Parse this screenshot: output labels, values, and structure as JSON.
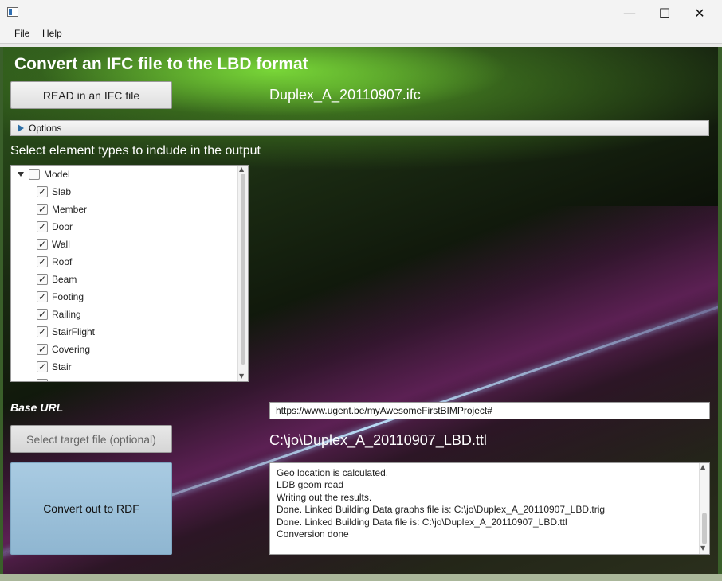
{
  "window": {
    "minimize_glyph": "—",
    "maximize_glyph": "☐",
    "close_glyph": "✕"
  },
  "menu": {
    "items": [
      "File",
      "Help"
    ]
  },
  "main": {
    "title": "Convert an IFC file to the LBD  format",
    "read_button_label": "READ in an IFC file",
    "input_filename": "Duplex_A_20110907.ifc",
    "options_label": "Options",
    "select_label": "Select element types to include in the output",
    "tree": {
      "root": {
        "label": "Model",
        "checked": false
      },
      "items": [
        {
          "label": "Slab",
          "checked": true
        },
        {
          "label": "Member",
          "checked": true
        },
        {
          "label": "Door",
          "checked": true
        },
        {
          "label": "Wall",
          "checked": true
        },
        {
          "label": "Roof",
          "checked": true
        },
        {
          "label": "Beam",
          "checked": true
        },
        {
          "label": "Footing",
          "checked": true
        },
        {
          "label": "Railing",
          "checked": true
        },
        {
          "label": "StairFlight",
          "checked": true
        },
        {
          "label": "Covering",
          "checked": true
        },
        {
          "label": "Stair",
          "checked": true
        }
      ]
    },
    "base_url_label": "Base URL",
    "base_url_value": "https://www.ugent.be/myAwesomeFirstBIMProject#",
    "select_target_label": "Select target file (optional)",
    "target_filename": "C:\\jo\\Duplex_A_20110907_LBD.ttl",
    "convert_button_label": "Convert out to RDF",
    "log_lines": [
      "Geo location is calculated.",
      "LDB geom read",
      "Writing out the results.",
      "Done. Linked Building Data graphs file is: C:\\jo\\Duplex_A_20110907_LBD.trig",
      "Done. Linked Building Data file is: C:\\jo\\Duplex_A_20110907_LBD.ttl",
      "Conversion done"
    ]
  },
  "colors": {
    "accent_blue": "#2d6ea6",
    "convert_button": "#9fc2db",
    "background_green": "#3a5f2a"
  }
}
